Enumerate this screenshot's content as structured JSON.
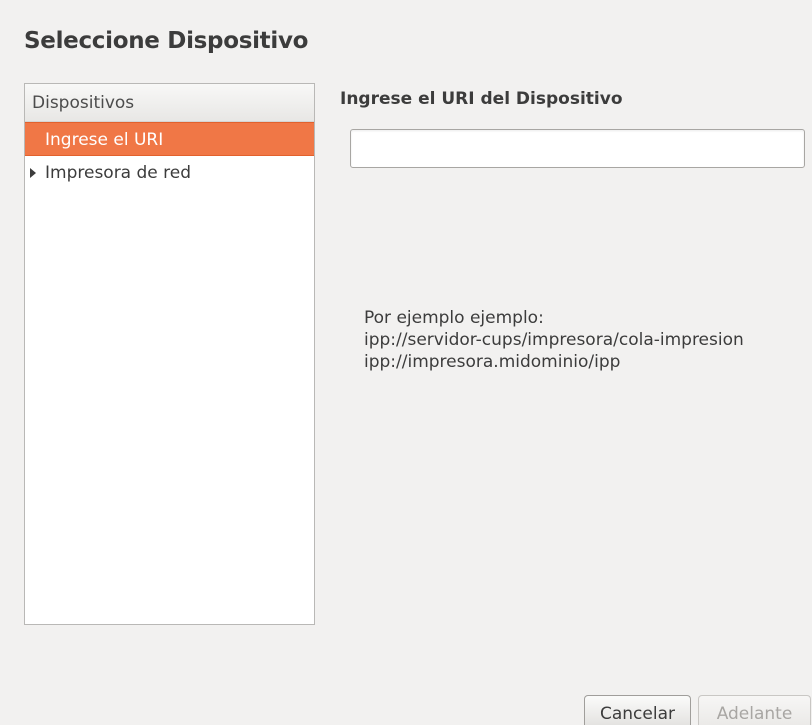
{
  "page": {
    "title": "Seleccione Dispositivo"
  },
  "devices": {
    "header": "Dispositivos",
    "items": [
      {
        "label": "Ingrese el URI",
        "selected": true,
        "expandable": false
      },
      {
        "label": "Impresora de red",
        "selected": false,
        "expandable": true
      }
    ]
  },
  "uri_form": {
    "heading": "Ingrese el URI del Dispositivo",
    "value": "",
    "example_lines": [
      "Por ejemplo ejemplo:",
      "ipp://servidor-cups/impresora/cola-impresion",
      "ipp://impresora.midominio/ipp"
    ]
  },
  "buttons": {
    "cancel_label": "Cancelar",
    "forward_label": "Adelante",
    "forward_enabled": false
  },
  "colors": {
    "selection": "#f07746",
    "background": "#f2f1f0",
    "disabled_text": "#a8a6a3"
  }
}
